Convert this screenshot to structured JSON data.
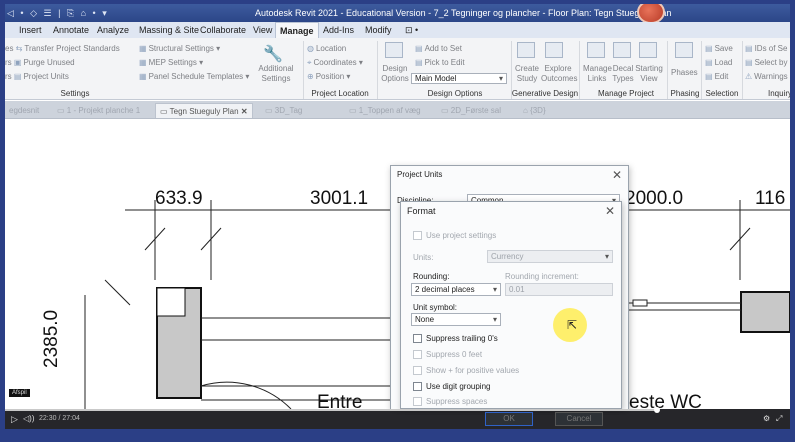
{
  "window": {
    "title": "Autodesk Revit 2021 - Educational Version - 7_2 Tegninger og plancher - Floor Plan: Tegn Stueguly Plan",
    "qat_symbols": "◁ • ◇ ☰ | ⎘ ⌂ • ▾"
  },
  "ribbon_tabs": [
    "Insert",
    "Annotate",
    "Analyze",
    "Massing & Site",
    "Collaborate",
    "View",
    "Manage",
    "Add-Ins",
    "Modify",
    "⊡ •"
  ],
  "active_tab": "Manage",
  "ribbon": {
    "settings_items": [
      "Transfer Project Standards",
      "Purge Unused",
      "Project Units"
    ],
    "settings_prefix": [
      "es",
      "rs",
      "rs"
    ],
    "settings_items2": [
      "Structural Settings ▾",
      "MEP Settings ▾",
      "Panel Schedule Templates ▾"
    ],
    "additional_settings": "Additional Settings",
    "project_location_items": [
      "Location",
      "Coordinates ▾",
      "Position ▾"
    ],
    "design_options": "Design Options",
    "add_to_set": "Add to Set",
    "pick_to_edit": "Pick to Edit",
    "main_model": "Main Model",
    "create_study": "Create Study",
    "explore_outcomes": "Explore Outcomes",
    "manage_links": "Manage Links",
    "decal_types": "Decal Types",
    "starting_view": "Starting View",
    "phases": "Phases",
    "selection_items": [
      "Save",
      "Load",
      "Edit"
    ],
    "inquiry_items": [
      "IDs of Se",
      "Select by",
      "Warnings"
    ],
    "panels": [
      "Settings",
      "Project Location",
      "Design Options",
      "Generative Design",
      "Manage Project",
      "Phasing",
      "Selection",
      "Inquiry"
    ]
  },
  "view_tabs": [
    {
      "label": "egdesnit",
      "active": false
    },
    {
      "label": "1 - Projekt planche 1",
      "active": false
    },
    {
      "label": "Tegn Stueguly Plan",
      "active": true
    },
    {
      "label": "3D_Tag",
      "active": false
    },
    {
      "label": "1_Toppen af væg",
      "active": false
    },
    {
      "label": "2D_Første sal",
      "active": false
    },
    {
      "label": "{3D}",
      "active": false
    }
  ],
  "canvas": {
    "dim_1": "633.9",
    "dim_2": "3001.1",
    "dim_3": "2000.0",
    "dim_4": "116",
    "dim_vertical": "2385.0",
    "room_1": "Entre",
    "room_2": "este WC"
  },
  "project_units_dialog": {
    "title": "Project Units",
    "discipline_label": "Discipline:",
    "discipline_value": "Common"
  },
  "format_dialog": {
    "title": "Format",
    "use_project_settings": "Use project settings",
    "units_label": "Units:",
    "units_value": "Currency",
    "rounding_label": "Rounding:",
    "rounding_value": "2 decimal places",
    "rounding_increment_label": "Rounding increment:",
    "rounding_increment_value": "0.01",
    "unit_symbol_label": "Unit symbol:",
    "unit_symbol_value": "None",
    "suppress_trailing": "Suppress trailing 0's",
    "suppress_feet": "Suppress 0 feet",
    "show_plus": "Show + for positive values",
    "use_digit_grouping": "Use digit grouping",
    "suppress_spaces": "Suppress spaces",
    "ok": "OK",
    "cancel": "Cancel"
  },
  "player": {
    "time": "22:30 / 27:04",
    "badge": "Afspil"
  }
}
